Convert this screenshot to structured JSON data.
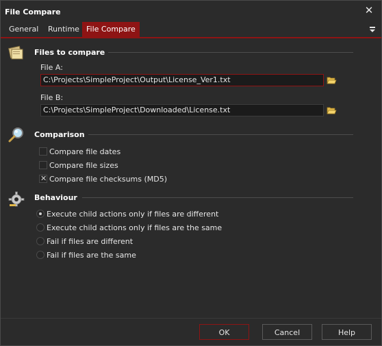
{
  "window": {
    "title": "File Compare"
  },
  "tabs": [
    {
      "label": "General",
      "active": false
    },
    {
      "label": "Runtime",
      "active": false
    },
    {
      "label": "File Compare",
      "active": true
    }
  ],
  "files_section": {
    "title": "Files to compare",
    "file_a_label": "File A:",
    "file_a_value": "C:\\Projects\\SimpleProject\\Output\\License_Ver1.txt",
    "file_b_label": "File B:",
    "file_b_value": "C:\\Projects\\SimpleProject\\Downloaded\\License.txt"
  },
  "comparison_section": {
    "title": "Comparison",
    "options": [
      {
        "label": "Compare file dates",
        "checked": false
      },
      {
        "label": "Compare file sizes",
        "checked": false
      },
      {
        "label": "Compare file checksums (MD5)",
        "checked": true
      }
    ]
  },
  "behaviour_section": {
    "title": "Behaviour",
    "options": [
      {
        "label": "Execute child actions only if files are different",
        "selected": true
      },
      {
        "label": "Execute child actions only if files are the same",
        "selected": false
      },
      {
        "label": "Fail if files are different",
        "selected": false
      },
      {
        "label": "Fail if files are the same",
        "selected": false
      }
    ]
  },
  "footer": {
    "ok_label": "OK",
    "cancel_label": "Cancel",
    "help_label": "Help"
  },
  "colors": {
    "accent": "#8e1414",
    "background": "#2b2b2b",
    "text": "#e6e6e6"
  },
  "icons": {
    "close": "close-icon",
    "menu": "menu-icon",
    "files": "folder-files-icon",
    "comparison": "magnifier-icon",
    "behaviour": "gear-icon",
    "browse": "folder-open-icon"
  }
}
